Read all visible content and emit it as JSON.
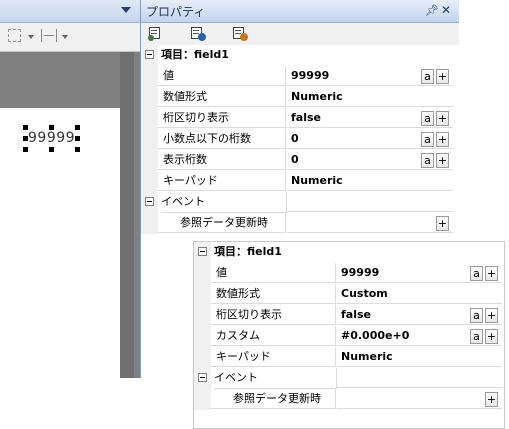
{
  "properties_panel": {
    "title": "プロパティ",
    "pin_icon": "pin-icon",
    "close_icon": "close-icon"
  },
  "canvas": {
    "field_text": "99999"
  },
  "grid1": {
    "category_title": "項目：field1",
    "rows": [
      {
        "name": "値",
        "value": "99999",
        "buttons": [
          "a",
          "+"
        ]
      },
      {
        "name": "数値形式",
        "value": "Numeric",
        "buttons": []
      },
      {
        "name": "桁区切り表示",
        "value": "false",
        "buttons": [
          "a",
          "+"
        ]
      },
      {
        "name": "小数点以下の桁数",
        "value": "0",
        "buttons": [
          "a",
          "+"
        ]
      },
      {
        "name": "表示桁数",
        "value": "0",
        "buttons": [
          "a",
          "+"
        ]
      },
      {
        "name": "キーパッド",
        "value": "Numeric",
        "buttons": []
      }
    ],
    "event_category": "イベント",
    "event_row": {
      "name": "参照データ更新時",
      "value": "",
      "buttons": [
        "+"
      ]
    }
  },
  "grid2": {
    "category_title": "項目：field1",
    "rows": [
      {
        "name": "値",
        "value": "99999",
        "buttons": [
          "a",
          "+"
        ]
      },
      {
        "name": "数値形式",
        "value": "Custom",
        "buttons": []
      },
      {
        "name": "桁区切り表示",
        "value": "false",
        "buttons": [
          "a",
          "+"
        ]
      },
      {
        "name": "カスタム",
        "value": "#0.000e+0",
        "buttons": [
          "a",
          "+"
        ]
      },
      {
        "name": "キーパッド",
        "value": "Numeric",
        "buttons": []
      }
    ],
    "event_category": "イベント",
    "event_row": {
      "name": "参照データ更新時",
      "value": "",
      "buttons": [
        "+"
      ]
    }
  }
}
